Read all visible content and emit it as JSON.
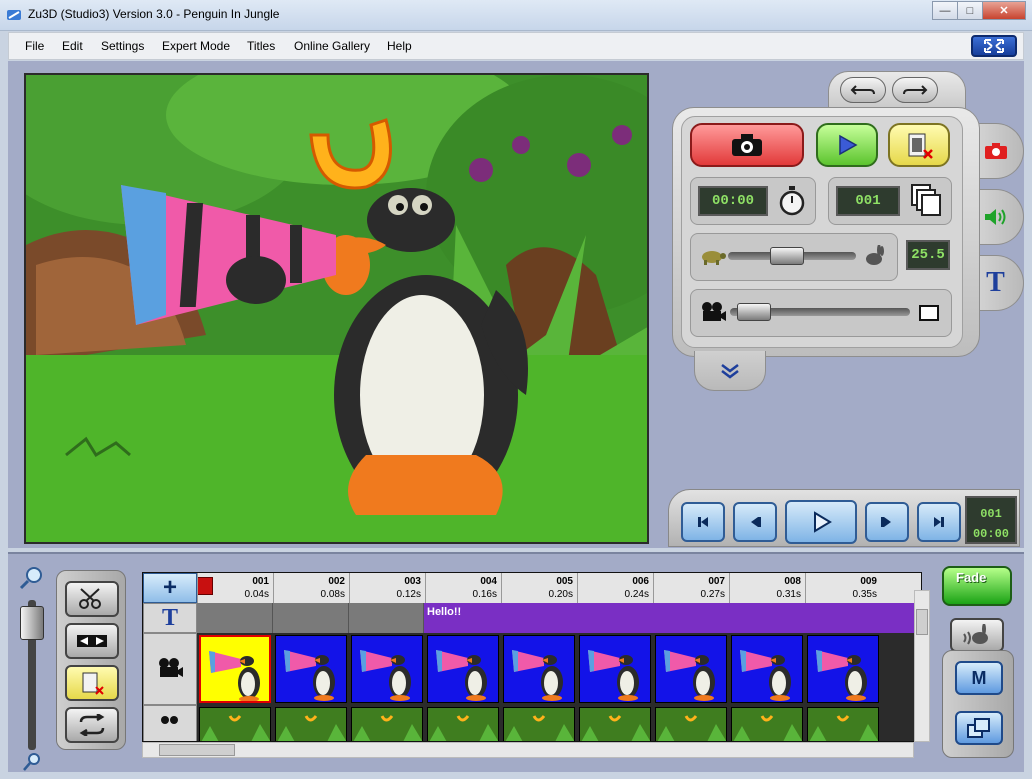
{
  "window": {
    "title": "Zu3D (Studio3) Version 3.0 - Penguin In Jungle",
    "minimize_label": "—",
    "maximize_label": "□",
    "close_label": "✕"
  },
  "menu": {
    "items": [
      "File",
      "Edit",
      "Settings",
      "Expert Mode",
      "Titles",
      "Online Gallery",
      "Help"
    ],
    "fullscreen_icon": "fullscreen-icon"
  },
  "stage": {
    "description_icon": "penguin-scene"
  },
  "capture_panel": {
    "timer_value": "00:00",
    "frame_value": "001",
    "speed_value": "25.5",
    "speed_level": 0.45,
    "onion_level": 0.05,
    "side_tabs": [
      "camera-tab",
      "audio-tab",
      "titles-tab"
    ],
    "titles_tab_label": "T",
    "collapse_label": "»"
  },
  "transport": {
    "counter_frame": "001",
    "counter_time": "00:00",
    "buttons": [
      "go-to-start",
      "step-back",
      "play",
      "step-forward",
      "go-to-end"
    ]
  },
  "timeline": {
    "add_label": "+",
    "title_track_label": "T",
    "title_clip_text": "Hello!!",
    "frames": [
      {
        "num": "001",
        "time": "0.04s"
      },
      {
        "num": "002",
        "time": "0.08s"
      },
      {
        "num": "003",
        "time": "0.12s"
      },
      {
        "num": "004",
        "time": "0.16s"
      },
      {
        "num": "005",
        "time": "0.20s"
      },
      {
        "num": "006",
        "time": "0.24s"
      },
      {
        "num": "007",
        "time": "0.27s"
      },
      {
        "num": "008",
        "time": "0.31s"
      },
      {
        "num": "009",
        "time": "0.35s"
      }
    ]
  },
  "right_tools": {
    "fade_label": "Fade",
    "m_label": "M"
  },
  "colors": {
    "accent_blue": "#1313e8",
    "title_purple": "#7a2fc4",
    "capture_red": "#ef4a4a",
    "play_green": "#7be04f",
    "lcd_green": "#8ee065"
  }
}
